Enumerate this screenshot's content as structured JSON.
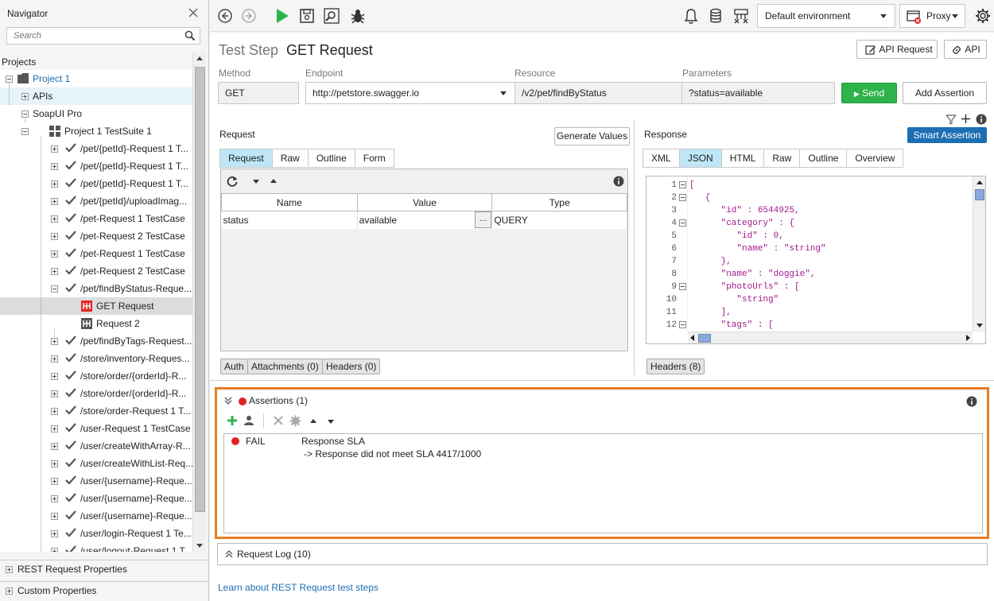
{
  "navigator": {
    "title": "Navigator",
    "search_placeholder": "Search",
    "projects_label": "Projects",
    "tree": [
      {
        "label": "Project 1",
        "indent": 0,
        "icon": "folder-icon",
        "expander": "minus",
        "accent": true
      },
      {
        "label": "APIs",
        "indent": 1,
        "icon": "none",
        "expander": "plus",
        "highlight": true
      },
      {
        "label": "SoapUI Pro",
        "indent": 1,
        "icon": "none",
        "expander": "minus"
      },
      {
        "label": "Project 1 TestSuite 1",
        "indent": 2,
        "icon": "testsuite-icon",
        "expander": "minus"
      },
      {
        "label": "/pet/{petId}-Request 1 T...",
        "indent": 3,
        "icon": "check-icon",
        "expander": "plus"
      },
      {
        "label": "/pet/{petId}-Request 1 T...",
        "indent": 3,
        "icon": "check-icon",
        "expander": "plus"
      },
      {
        "label": "/pet/{petId}-Request 1 T...",
        "indent": 3,
        "icon": "check-icon",
        "expander": "plus"
      },
      {
        "label": "/pet/{petId}/uploadImag...",
        "indent": 3,
        "icon": "check-icon",
        "expander": "plus"
      },
      {
        "label": "/pet-Request 1 TestCase",
        "indent": 3,
        "icon": "check-icon",
        "expander": "plus"
      },
      {
        "label": "/pet-Request 2 TestCase",
        "indent": 3,
        "icon": "check-icon",
        "expander": "plus"
      },
      {
        "label": "/pet-Request 1 TestCase",
        "indent": 3,
        "icon": "check-icon",
        "expander": "plus"
      },
      {
        "label": "/pet-Request 2 TestCase",
        "indent": 3,
        "icon": "check-icon",
        "expander": "plus"
      },
      {
        "label": "/pet/findByStatus-Reque...",
        "indent": 3,
        "icon": "check-icon",
        "expander": "minus"
      },
      {
        "label": "GET Request",
        "indent": 4,
        "icon": "request-error-icon",
        "expander": "none",
        "selected": true
      },
      {
        "label": "Request 2",
        "indent": 4,
        "icon": "request-icon",
        "expander": "none"
      },
      {
        "label": "/pet/findByTags-Request...",
        "indent": 3,
        "icon": "check-icon",
        "expander": "plus"
      },
      {
        "label": "/store/inventory-Reques...",
        "indent": 3,
        "icon": "check-icon",
        "expander": "plus"
      },
      {
        "label": "/store/order/{orderId}-R...",
        "indent": 3,
        "icon": "check-icon",
        "expander": "plus"
      },
      {
        "label": "/store/order/{orderId}-R...",
        "indent": 3,
        "icon": "check-icon",
        "expander": "plus"
      },
      {
        "label": "/store/order-Request 1 T...",
        "indent": 3,
        "icon": "check-icon",
        "expander": "plus"
      },
      {
        "label": "/user-Request 1 TestCase",
        "indent": 3,
        "icon": "check-icon",
        "expander": "plus"
      },
      {
        "label": "/user/createWithArray-R...",
        "indent": 3,
        "icon": "check-icon",
        "expander": "plus"
      },
      {
        "label": "/user/createWithList-Req...",
        "indent": 3,
        "icon": "check-icon",
        "expander": "plus"
      },
      {
        "label": "/user/{username}-Reque...",
        "indent": 3,
        "icon": "check-icon",
        "expander": "plus"
      },
      {
        "label": "/user/{username}-Reque...",
        "indent": 3,
        "icon": "check-icon",
        "expander": "plus"
      },
      {
        "label": "/user/{username}-Reque...",
        "indent": 3,
        "icon": "check-icon",
        "expander": "plus"
      },
      {
        "label": "/user/login-Request 1 Te...",
        "indent": 3,
        "icon": "check-icon",
        "expander": "plus"
      },
      {
        "label": "/user/logout-Request 1 T...",
        "indent": 3,
        "icon": "check-icon",
        "expander": "plus"
      }
    ],
    "bottom_panels": [
      "REST Request Properties",
      "Custom Properties"
    ]
  },
  "toolbar": {
    "environment": "Default environment",
    "proxy": "Proxy"
  },
  "step": {
    "type_label": "Test Step",
    "name": "GET Request",
    "api_request_button": "API Request",
    "api_button": "API"
  },
  "fields": {
    "method_label": "Method",
    "method_value": "GET",
    "endpoint_label": "Endpoint",
    "endpoint_value": "http://petstore.swagger.io",
    "resource_label": "Resource",
    "resource_value": "/v2/pet/findByStatus",
    "parameters_label": "Parameters",
    "parameters_value": "?status=available",
    "send_button": "Send",
    "add_assertion_button": "Add Assertion"
  },
  "request": {
    "label": "Request",
    "generate_button": "Generate Values",
    "tabs": [
      "Request",
      "Raw",
      "Outline",
      "Form"
    ],
    "active_tab": 0,
    "columns": [
      "Name",
      "Value",
      "Type"
    ],
    "rows": [
      {
        "name": "status",
        "value": "available",
        "type": "QUERY",
        "more": "..."
      }
    ],
    "bottom_tabs": [
      "Auth",
      "Attachments (0)",
      "Headers (0)"
    ]
  },
  "response": {
    "label": "Response",
    "smart_assertion_button": "Smart Assertion",
    "tabs": [
      "XML",
      "JSON",
      "HTML",
      "Raw",
      "Outline",
      "Overview"
    ],
    "active_tab": 1,
    "json_lines": [
      {
        "n": "1",
        "fold": true,
        "text": "["
      },
      {
        "n": "2",
        "fold": true,
        "text": "   {"
      },
      {
        "n": "3",
        "fold": false,
        "text": "      \"id\" : 6544925,"
      },
      {
        "n": "4",
        "fold": true,
        "text": "      \"category\" : {"
      },
      {
        "n": "5",
        "fold": false,
        "text": "         \"id\" : 0,"
      },
      {
        "n": "6",
        "fold": false,
        "text": "         \"name\" : \"string\""
      },
      {
        "n": "7",
        "fold": false,
        "text": "      },"
      },
      {
        "n": "8",
        "fold": false,
        "text": "      \"name\" : \"doggie\","
      },
      {
        "n": "9",
        "fold": true,
        "text": "      \"photoUrls\" : ["
      },
      {
        "n": "10",
        "fold": false,
        "text": "         \"string\""
      },
      {
        "n": "11",
        "fold": false,
        "text": "      ],"
      },
      {
        "n": "12",
        "fold": true,
        "text": "      \"tags\" : ["
      }
    ],
    "bottom_tabs": [
      "Headers (8)"
    ]
  },
  "assertions": {
    "title": "Assertions (1)",
    "items": [
      {
        "status": "FAIL",
        "name": "Response SLA",
        "detail": "-> Response did not meet SLA 4417/1000"
      }
    ]
  },
  "request_log": {
    "title": "Request Log (10)"
  },
  "footer": {
    "learn_link": "Learn about REST Request test steps"
  },
  "colors": {
    "accent_blue": "#1c6fb3",
    "send_green": "#2db34a",
    "fail_red": "#e02424",
    "assert_border": "#e67e22",
    "tab_active": "#bfe6f6"
  }
}
